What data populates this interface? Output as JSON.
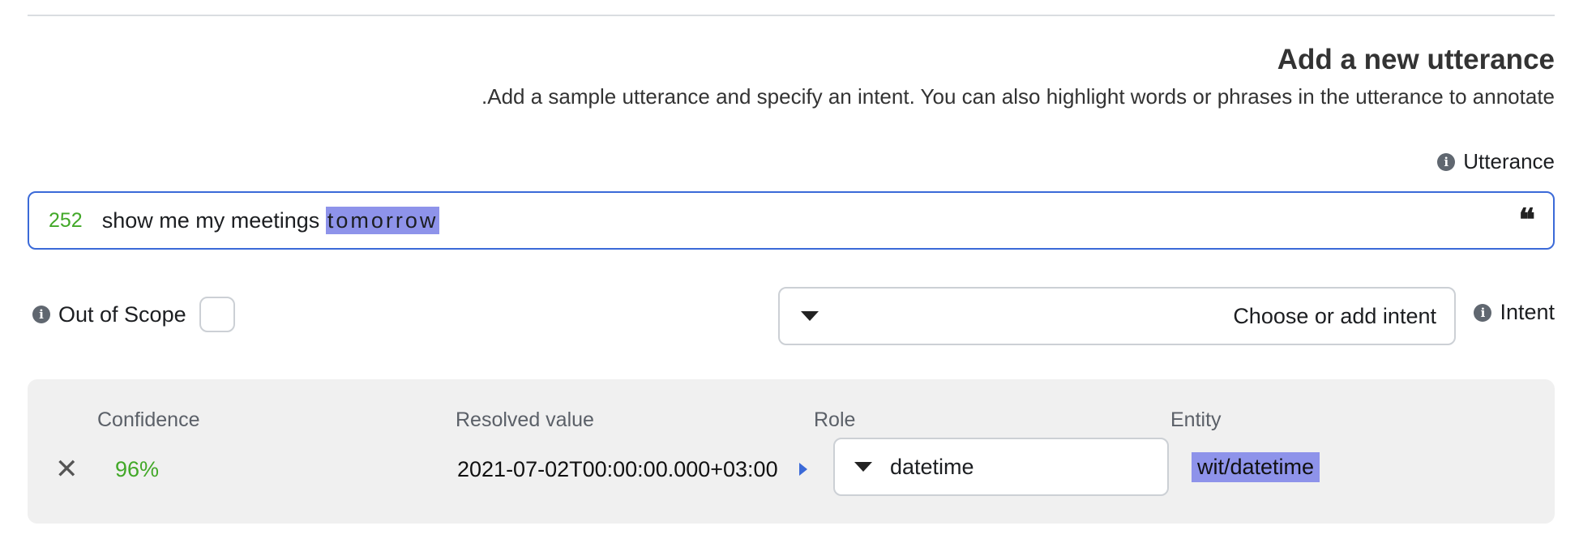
{
  "header": {
    "title": "Add a new utterance",
    "subtitle": ".Add a sample utterance and specify an intent. You can also highlight words or phrases in the utterance to annotate"
  },
  "utterance": {
    "label": "Utterance",
    "char_count": "252",
    "text_before": "show me my meetings ",
    "highlighted_text": "tomorrow",
    "quote_icon": "quote-icon"
  },
  "out_of_scope": {
    "label": "Out of Scope",
    "checked": false
  },
  "intent": {
    "label": "Intent",
    "placeholder": "Choose or add intent"
  },
  "entity_panel": {
    "headers": {
      "confidence": "Confidence",
      "resolved_value": "Resolved value",
      "role": "Role",
      "entity": "Entity"
    },
    "row": {
      "confidence": "96%",
      "resolved_value": "2021-07-02T00:00:00.000+03:00",
      "role": "datetime",
      "entity": "wit/datetime"
    }
  },
  "colors": {
    "accent_blue": "#3b6ad8",
    "highlight": "#8e93ea",
    "confidence_green": "#42a828",
    "panel_bg": "#f0f0f0"
  }
}
